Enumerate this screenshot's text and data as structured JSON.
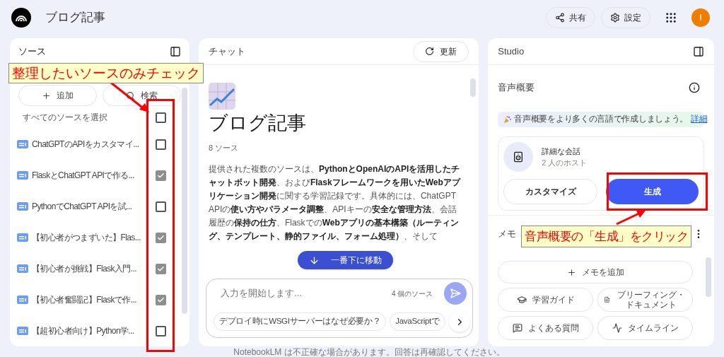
{
  "header": {
    "title": "ブログ記事",
    "buttons": [
      {
        "kind": "share",
        "label": "共有"
      },
      {
        "kind": "settings",
        "label": "設定"
      }
    ],
    "avatar": "I"
  },
  "sources": {
    "title": "ソース",
    "add": "追加",
    "search": "検索",
    "select_all": {
      "label": "すべてのソースを選択",
      "checked": false
    },
    "items": [
      {
        "label": "ChatGPTのAPIをカスタマイ...",
        "checked": false
      },
      {
        "label": "FlaskとChatGPT APIで作る...",
        "checked": true
      },
      {
        "label": "PythonでChatGPT APIを試...",
        "checked": false
      },
      {
        "label": "【初心者がつまずいた】Flas...",
        "checked": true
      },
      {
        "label": "【初心者が挑戦】Flask入門...",
        "checked": true
      },
      {
        "label": "【初心者奮闘記】Flaskで作...",
        "checked": true
      },
      {
        "label": "【超初心者向け】Python学...",
        "checked": false
      }
    ]
  },
  "chat": {
    "title": "チャット",
    "refresh": "更新",
    "notebook_title": "ブログ記事",
    "source_count": "8 ソース",
    "summary": "提供された複数のソースは、**PythonとOpenAIのAPIを活用したチャットボット開発**、および**Flaskフレームワークを用いたWebアプリケーション開発**に関する学習記録です。具体的には、ChatGPT APIの**使い方やパラメータ調整**、APIキーの**安全な管理方法**、会話履歴の**保持の仕方**、Flaskでの**Webアプリの基本構築（ルーティング、テンプレート、静的ファイル、フォーム処理）**、そして",
    "scroll_button": "一番下に移動",
    "input": {
      "placeholder": "入力を開始します..."
    },
    "selected_sources": "4 個のソース",
    "suggestions": [
      "デプロイ時にWSGIサーバーはなぜ必要か？",
      "JavaScriptで"
    ]
  },
  "studio": {
    "title": "Studio",
    "audio_title": "音声概要",
    "banner": "音声概要をより多くの言語で作成しましょう。",
    "banner_link": "詳細",
    "audio_card": {
      "title": "詳細な会話",
      "subtitle": "2 人のホスト",
      "customize": "カスタマイズ",
      "generate": "生成"
    },
    "memo_title": "メモ",
    "add_memo": "メモを追加",
    "tools": [
      {
        "kind": "guide",
        "label": "学習ガイド"
      },
      {
        "kind": "doc",
        "label": "ブリーフィング・ドキュメント"
      },
      {
        "kind": "faq",
        "label": "よくある質問"
      },
      {
        "kind": "timeline",
        "label": "タイムライン"
      }
    ]
  },
  "footer": "NotebookLM は不正確な場合があります。回答は再確認してください。",
  "annotations": [
    "整理したいソースのみチェック",
    "音声概要の「生成」をクリック"
  ]
}
